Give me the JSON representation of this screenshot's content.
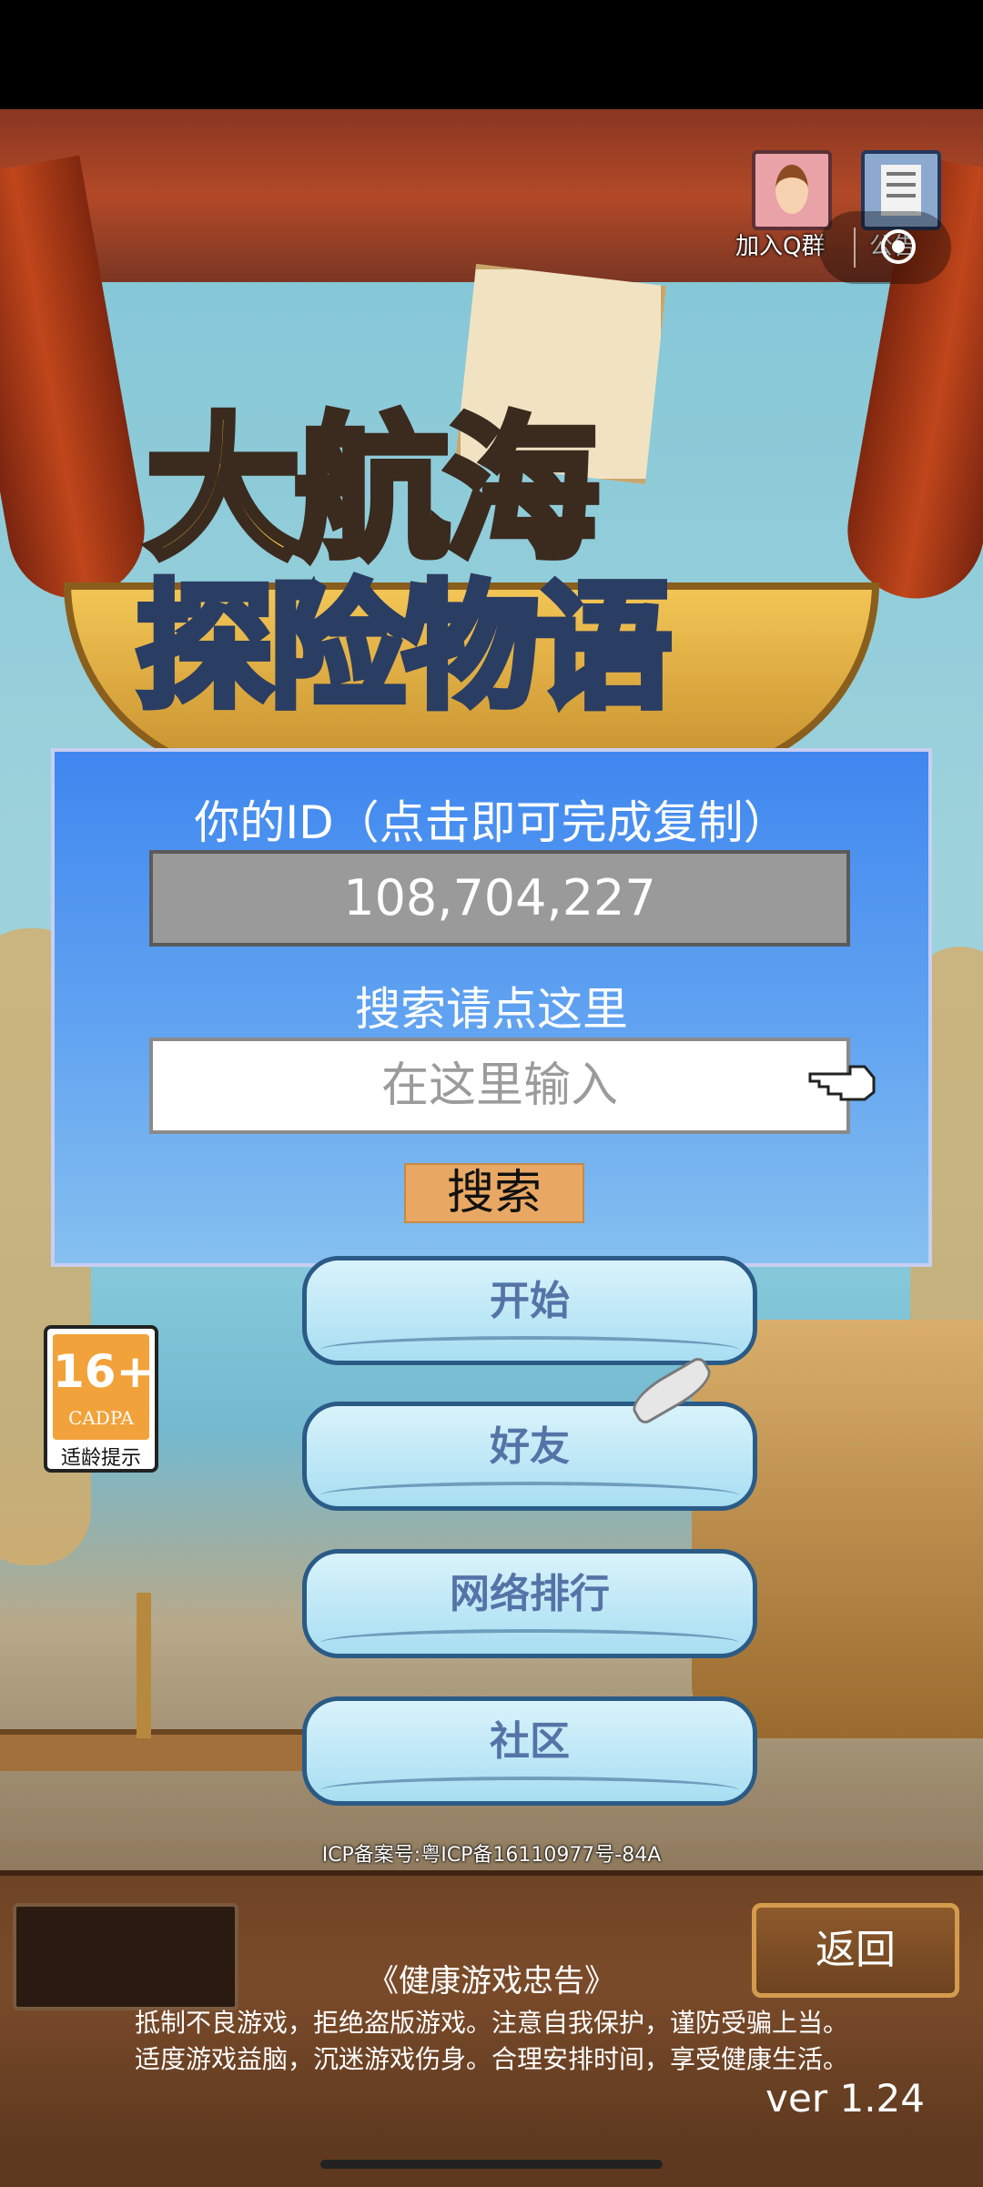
{
  "header": {
    "group_join_label": "加入Q群",
    "notice_label": "公告"
  },
  "logo": {
    "line1": "大航海",
    "line2": "探险物语"
  },
  "id_panel": {
    "title": "你的ID（点击即可完成复制）",
    "id_value": "108,704,227",
    "search_title": "搜索请点这里",
    "search_placeholder": "在这里输入",
    "search_button": "搜索"
  },
  "menu": {
    "start": "开始",
    "friends": "好友",
    "ranking": "网络排行",
    "community": "社区"
  },
  "age_badge": {
    "rating": "16+",
    "org": "CADPA",
    "caption": "适龄提示"
  },
  "footer": {
    "icp": "ICP备案号:粤ICP备16110977号-84A",
    "back_button": "返回",
    "health_title": "《健康游戏忠告》",
    "health_line1": "抵制不良游戏，拒绝盗版游戏。注意自我保护，谨防受骗上当。",
    "health_line2": "适度游戏益脑，沉迷游戏伤身。合理安排时间，享受健康生活。",
    "version": "ver 1.24"
  }
}
